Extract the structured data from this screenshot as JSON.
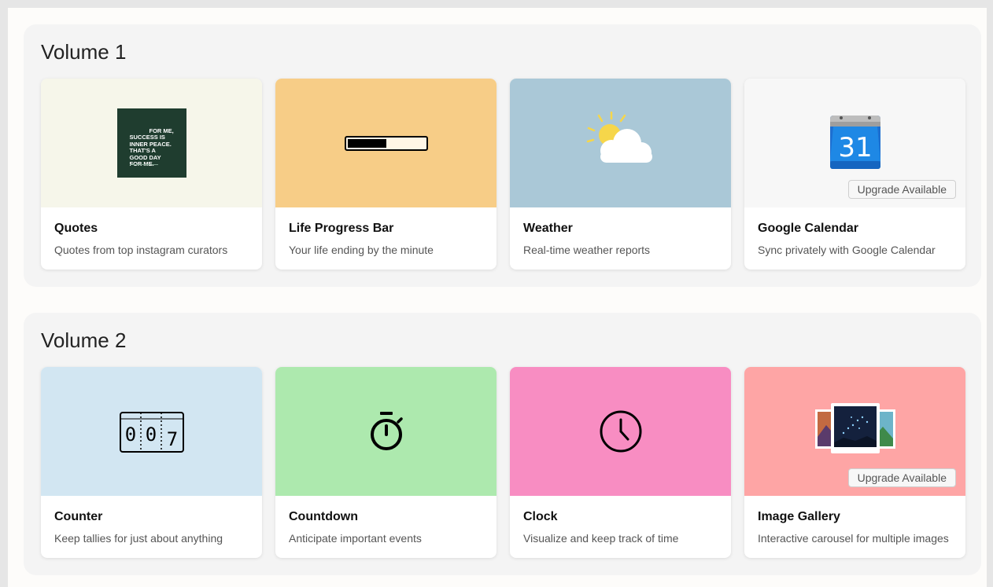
{
  "volumes": [
    {
      "title": "Volume 1",
      "cards": [
        {
          "title": "Quotes",
          "description": "Quotes from top instagram curators",
          "bg": "#f6f6ea",
          "icon": "quote-image-icon",
          "quote_text": "FOR ME,\nSUCCESS IS\nINNER PEACE.\nTHAT'S A\nGOOD DAY\nFOR ME."
        },
        {
          "title": "Life Progress Bar",
          "description": "Your life ending by the minute",
          "bg": "#f7cd87",
          "icon": "progress-bar-icon",
          "progress_fraction": 0.5
        },
        {
          "title": "Weather",
          "description": "Real-time weather reports",
          "bg": "#aac8d7",
          "icon": "sun-cloud-icon"
        },
        {
          "title": "Google Calendar",
          "description": "Sync privately with Google Calendar",
          "bg": "#f7f7f7",
          "icon": "calendar-icon",
          "calendar_day": "31",
          "badge": "Upgrade Available"
        }
      ]
    },
    {
      "title": "Volume 2",
      "cards": [
        {
          "title": "Counter",
          "description": "Keep tallies for just about anything",
          "bg": "#d2e6f2",
          "icon": "counter-icon",
          "digits": [
            "0",
            "0",
            "7"
          ]
        },
        {
          "title": "Countdown",
          "description": "Anticipate important events",
          "bg": "#ade9ae",
          "icon": "stopwatch-icon"
        },
        {
          "title": "Clock",
          "description": "Visualize and keep track of time",
          "bg": "#f88dc2",
          "icon": "clock-icon"
        },
        {
          "title": "Image Gallery",
          "description": "Interactive carousel for multiple images",
          "bg": "#fea5a5",
          "icon": "gallery-icon",
          "badge": "Upgrade Available"
        }
      ]
    }
  ]
}
